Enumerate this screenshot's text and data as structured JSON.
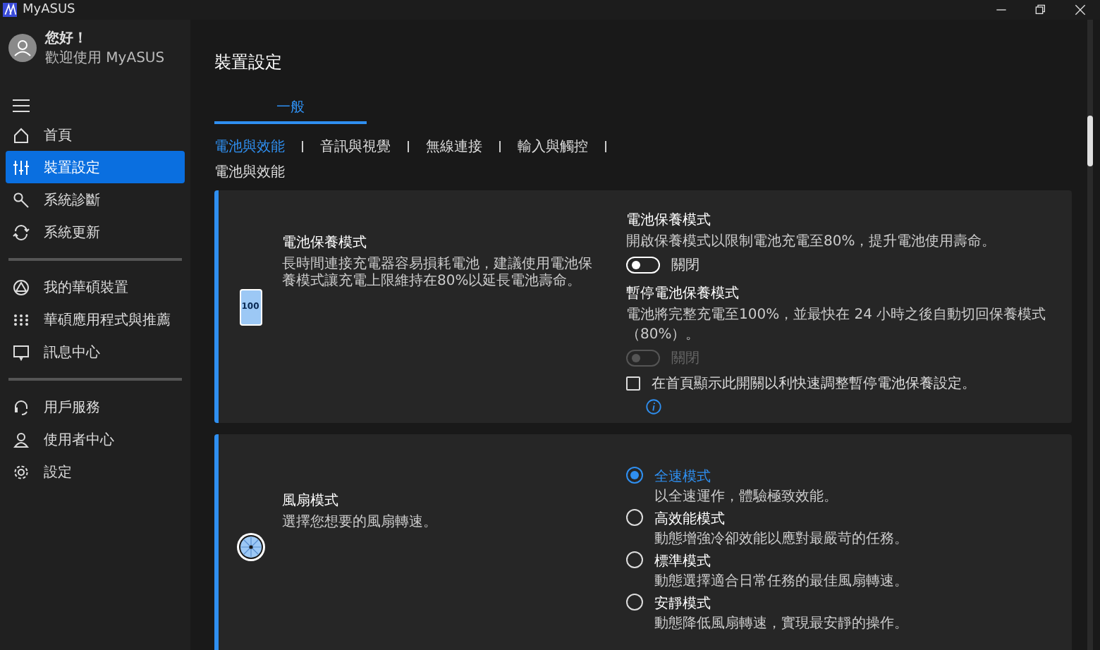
{
  "window": {
    "title": "MyASUS"
  },
  "profile": {
    "greeting": "您好！",
    "welcome": "歡迎使用 MyASUS"
  },
  "sidebar": {
    "groups": [
      [
        {
          "label": "首頁",
          "selected": false
        },
        {
          "label": "裝置設定",
          "selected": true
        },
        {
          "label": "系統診斷",
          "selected": false
        },
        {
          "label": "系統更新",
          "selected": false
        }
      ],
      [
        {
          "label": "我的華碩裝置",
          "selected": false
        },
        {
          "label": "華碩應用程式與推薦",
          "selected": false
        },
        {
          "label": "訊息中心",
          "selected": false
        }
      ],
      [
        {
          "label": "用戶服務",
          "selected": false
        },
        {
          "label": "使用者中心",
          "selected": false
        },
        {
          "label": "設定",
          "selected": false
        }
      ]
    ]
  },
  "page_title": "裝置設定",
  "tabs": [
    {
      "label": "一般",
      "selected": true
    }
  ],
  "subtabs": [
    {
      "label": "電池與效能",
      "selected": true
    },
    {
      "label": "音訊與視覺",
      "selected": false
    },
    {
      "label": "無線連接",
      "selected": false
    },
    {
      "label": "輸入與觸控",
      "selected": false
    }
  ],
  "section_title": "電池與效能",
  "cards": [
    {
      "kind": "battery",
      "icon_text": "100",
      "title": "電池保養模式",
      "description": "長時間連接充電器容易損耗電池，建議使用電池保養模式讓充電上限維持在80%以延長電池壽命。",
      "settings": [
        {
          "kind": "toggle",
          "title": "電池保養模式",
          "description": "開啟保養模式以限制電池充電至80%，提升電池使用壽命。",
          "on": false,
          "disabled": false,
          "state_label": "關閉"
        },
        {
          "kind": "toggle",
          "title": "暫停電池保養模式",
          "description": "電池將完整充電至100%，並最快在 24 小時之後自動切回保養模式（80%）。",
          "on": false,
          "disabled": true,
          "state_label": "關閉"
        },
        {
          "kind": "checkbox",
          "label": "在首頁顯示此開關以利快速調整暫停電池保養設定。",
          "checked": false,
          "info": true
        }
      ]
    },
    {
      "kind": "fan",
      "title": "風扇模式",
      "description": "選擇您想要的風扇轉速。",
      "options": [
        {
          "label": "全速模式",
          "description": "以全速運作，體驗極致效能。",
          "selected": true
        },
        {
          "label": "高效能模式",
          "description": "動態增強冷卻效能以應對最嚴苛的任務。",
          "selected": false
        },
        {
          "label": "標準模式",
          "description": "動態選擇適合日常任務的最佳風扇轉速。",
          "selected": false
        },
        {
          "label": "安靜模式",
          "description": "動態降低風扇轉速，實現最安靜的操作。",
          "selected": false
        }
      ]
    }
  ]
}
